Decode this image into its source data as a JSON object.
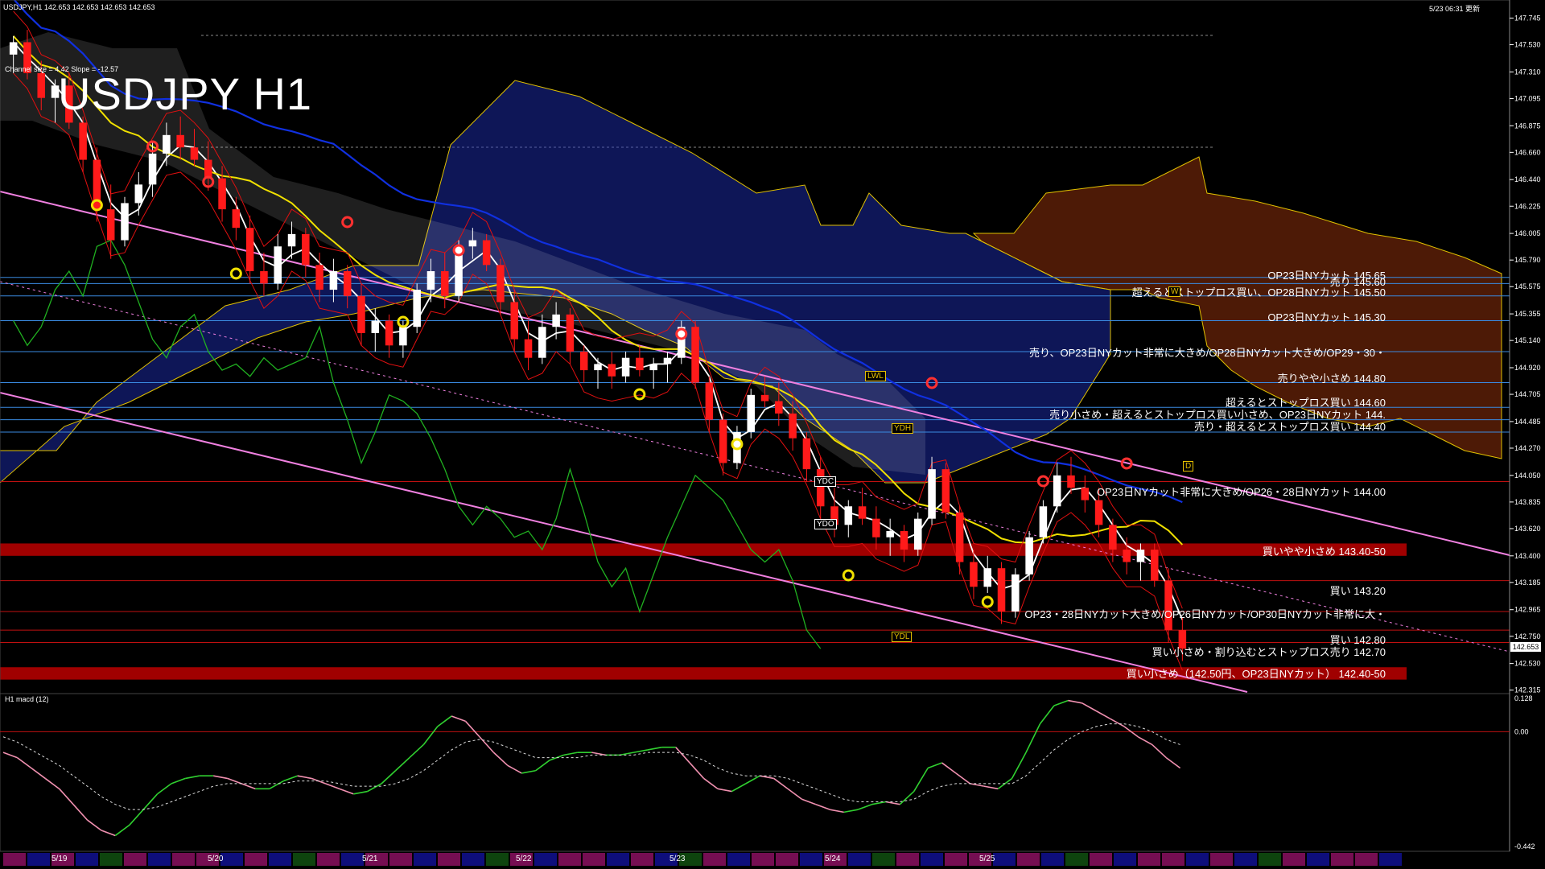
{
  "header": {
    "symbol_info": "USDJPY,H1  142.653 142.653 142.653 142.653",
    "datetime_label": "5/23 06:31 更新",
    "channel_info": "Channel size = 4.42  Slope = -12.57",
    "big_title": "USDJPY H1",
    "indicator_label": "H1  macd (12)",
    "current_price": "142.653"
  },
  "colors": {
    "background": "#000000",
    "bull_candle": "#ffffff",
    "bear_candle": "#ff1a1a",
    "ma_fast": "#ffffff",
    "ma_mid": "#f0e000",
    "ma_slow": "#1030e0",
    "channel": "#f080e0",
    "kumo_bull": "#2030c0",
    "kumo_bear": "#c04010",
    "lagging": "#20b020",
    "zone": "#a00000"
  },
  "levels": [
    {
      "text": "OP23日NYカット 145.65",
      "color": "#4aa0ff"
    },
    {
      "text": "売り 145.60",
      "color": "#4aa0ff"
    },
    {
      "text": "超えるとストップロス買い、OP28日NYカット 145.50",
      "color": "#4aa0ff"
    },
    {
      "text": "OP23日NYカット 145.30",
      "color": "#4aa0ff"
    },
    {
      "text": "売り、OP23日NYカット非常に大きめ/OP28日NYカット大きめ/OP29・30・",
      "color": "#4aa0ff"
    },
    {
      "text": "売りやや小さめ 144.80",
      "color": "#4aa0ff"
    },
    {
      "text": "超えるとストップロス買い 144.60",
      "color": "#4aa0ff"
    },
    {
      "text": "売り小さめ・超えるとストップロス買い小さめ、OP23日NYカット 144.",
      "color": "#4aa0ff"
    },
    {
      "text": "売り・超えるとストップロス買い 144.40",
      "color": "#4aa0ff"
    },
    {
      "text": "OP23日NYカット非常に大きめ/OP26・28日NYカット 144.00",
      "color": "#ff3030"
    },
    {
      "text": "買いやや小さめ 143.40-50",
      "color": "#ff3030"
    },
    {
      "text": "買い 143.20",
      "color": "#ff3030"
    },
    {
      "text": "OP23・28日NYカット大きめ/OP26日NYカット/OP30日NYカット非常に大・",
      "color": "#ff3030"
    },
    {
      "text": "買い 142.80",
      "color": "#ff3030"
    },
    {
      "text": "買い小さめ・割り込むとストップロス売り 142.70",
      "color": "#ff3030"
    },
    {
      "text": "買い小さめ（142.50円、OP23日NYカット） 142.40-50",
      "color": "#ff3030"
    }
  ],
  "tags": {
    "lwl": "LWL",
    "ydh": "YDH",
    "ydc": "YDC",
    "ydo": "YDO",
    "ydl": "YDL",
    "d": "D",
    "w": "W"
  },
  "x_dates": [
    "5/19",
    "5/20",
    "5/21",
    "5/22",
    "5/23",
    "5/24",
    "5/25"
  ],
  "chart_data": {
    "type": "candlestick",
    "title": "USDJPY H1",
    "y_axis_labels": [
      "147.745",
      "147.530",
      "147.310",
      "147.095",
      "146.875",
      "146.660",
      "146.440",
      "146.225",
      "146.005",
      "145.790",
      "145.575",
      "145.355",
      "145.140",
      "144.920",
      "144.705",
      "144.485",
      "144.270",
      "144.050",
      "143.835",
      "143.620",
      "143.400",
      "143.185",
      "142.965",
      "142.750",
      "142.530",
      "142.315"
    ],
    "ylim": [
      142.3,
      147.8
    ],
    "macd_axis_labels": [
      "0.128",
      "0.00",
      "-0.442"
    ],
    "macd_ylim": [
      -0.442,
      0.128
    ],
    "candles": [
      [
        147.45,
        147.6,
        147.3,
        147.55
      ],
      [
        147.55,
        147.65,
        147.25,
        147.3
      ],
      [
        147.3,
        147.4,
        147.0,
        147.1
      ],
      [
        147.1,
        147.25,
        146.9,
        147.2
      ],
      [
        147.2,
        147.3,
        146.85,
        146.9
      ],
      [
        146.9,
        146.95,
        146.5,
        146.6
      ],
      [
        146.6,
        146.7,
        146.1,
        146.2
      ],
      [
        146.2,
        146.4,
        145.8,
        145.95
      ],
      [
        145.95,
        146.3,
        145.9,
        146.25
      ],
      [
        146.25,
        146.5,
        146.15,
        146.4
      ],
      [
        146.4,
        146.75,
        146.3,
        146.65
      ],
      [
        146.65,
        146.9,
        146.55,
        146.8
      ],
      [
        146.8,
        146.95,
        146.6,
        146.7
      ],
      [
        146.7,
        146.85,
        146.55,
        146.6
      ],
      [
        146.6,
        146.75,
        146.35,
        146.45
      ],
      [
        146.45,
        146.55,
        146.1,
        146.2
      ],
      [
        146.2,
        146.3,
        145.95,
        146.05
      ],
      [
        146.05,
        146.15,
        145.6,
        145.7
      ],
      [
        145.7,
        145.85,
        145.5,
        145.6
      ],
      [
        145.6,
        146.0,
        145.55,
        145.9
      ],
      [
        145.9,
        146.1,
        145.8,
        146.0
      ],
      [
        146.0,
        146.05,
        145.65,
        145.75
      ],
      [
        145.75,
        145.85,
        145.45,
        145.55
      ],
      [
        145.55,
        145.8,
        145.45,
        145.7
      ],
      [
        145.7,
        145.75,
        145.4,
        145.5
      ],
      [
        145.5,
        145.6,
        145.1,
        145.2
      ],
      [
        145.2,
        145.4,
        145.05,
        145.3
      ],
      [
        145.3,
        145.35,
        145.0,
        145.1
      ],
      [
        145.1,
        145.3,
        145.0,
        145.25
      ],
      [
        145.25,
        145.6,
        145.2,
        145.55
      ],
      [
        145.55,
        145.8,
        145.45,
        145.7
      ],
      [
        145.7,
        145.85,
        145.4,
        145.5
      ],
      [
        145.5,
        145.95,
        145.45,
        145.9
      ],
      [
        145.9,
        146.05,
        145.8,
        145.95
      ],
      [
        145.95,
        146.0,
        145.7,
        145.75
      ],
      [
        145.75,
        145.8,
        145.35,
        145.45
      ],
      [
        145.45,
        145.55,
        145.05,
        145.15
      ],
      [
        145.15,
        145.3,
        144.9,
        145.0
      ],
      [
        145.0,
        145.35,
        144.95,
        145.25
      ],
      [
        145.25,
        145.45,
        145.15,
        145.35
      ],
      [
        145.35,
        145.4,
        144.95,
        145.05
      ],
      [
        145.05,
        145.1,
        144.8,
        144.9
      ],
      [
        144.9,
        145.0,
        144.75,
        144.95
      ],
      [
        144.95,
        145.05,
        144.75,
        144.85
      ],
      [
        144.85,
        145.05,
        144.8,
        145.0
      ],
      [
        145.0,
        145.1,
        144.85,
        144.9
      ],
      [
        144.9,
        145.0,
        144.75,
        144.95
      ],
      [
        144.95,
        145.05,
        144.8,
        145.0
      ],
      [
        145.0,
        145.3,
        144.95,
        145.25
      ],
      [
        145.25,
        145.3,
        144.75,
        144.8
      ],
      [
        144.8,
        144.85,
        144.4,
        144.5
      ],
      [
        144.5,
        144.55,
        144.05,
        144.15
      ],
      [
        144.15,
        144.45,
        144.1,
        144.4
      ],
      [
        144.4,
        144.75,
        144.35,
        144.7
      ],
      [
        144.7,
        144.85,
        144.6,
        144.65
      ],
      [
        144.65,
        144.8,
        144.45,
        144.55
      ],
      [
        144.55,
        144.65,
        144.25,
        144.35
      ],
      [
        144.35,
        144.4,
        144.0,
        144.1
      ],
      [
        144.1,
        144.2,
        143.7,
        143.8
      ],
      [
        143.8,
        143.95,
        143.55,
        143.65
      ],
      [
        143.65,
        143.85,
        143.55,
        143.8
      ],
      [
        143.8,
        143.95,
        143.65,
        143.7
      ],
      [
        143.7,
        143.8,
        143.45,
        143.55
      ],
      [
        143.55,
        143.7,
        143.4,
        143.6
      ],
      [
        143.6,
        143.65,
        143.35,
        143.45
      ],
      [
        143.45,
        143.75,
        143.4,
        143.7
      ],
      [
        143.7,
        144.2,
        143.65,
        144.1
      ],
      [
        144.1,
        144.15,
        143.7,
        143.75
      ],
      [
        143.75,
        143.8,
        143.25,
        143.35
      ],
      [
        143.35,
        143.45,
        143.05,
        143.15
      ],
      [
        143.15,
        143.4,
        143.1,
        143.3
      ],
      [
        143.3,
        143.35,
        142.85,
        142.95
      ],
      [
        142.95,
        143.3,
        142.9,
        143.25
      ],
      [
        143.25,
        143.6,
        143.2,
        143.55
      ],
      [
        143.55,
        143.85,
        143.5,
        143.8
      ],
      [
        143.8,
        144.15,
        143.75,
        144.05
      ],
      [
        144.05,
        144.2,
        143.9,
        143.95
      ],
      [
        143.95,
        144.05,
        143.75,
        143.85
      ],
      [
        143.85,
        143.95,
        143.55,
        143.65
      ],
      [
        143.65,
        143.7,
        143.35,
        143.45
      ],
      [
        143.45,
        143.55,
        143.25,
        143.35
      ],
      [
        143.35,
        143.5,
        143.2,
        143.45
      ],
      [
        143.45,
        143.5,
        143.15,
        143.2
      ],
      [
        143.2,
        143.3,
        142.7,
        142.8
      ],
      [
        142.8,
        142.9,
        142.55,
        142.65
      ]
    ],
    "macd": [
      -0.08,
      -0.1,
      -0.14,
      -0.18,
      -0.22,
      -0.28,
      -0.34,
      -0.38,
      -0.4,
      -0.36,
      -0.3,
      -0.24,
      -0.2,
      -0.18,
      -0.17,
      -0.17,
      -0.18,
      -0.2,
      -0.22,
      -0.22,
      -0.19,
      -0.17,
      -0.18,
      -0.2,
      -0.22,
      -0.24,
      -0.23,
      -0.2,
      -0.15,
      -0.1,
      -0.05,
      0.02,
      0.06,
      0.04,
      -0.02,
      -0.08,
      -0.13,
      -0.16,
      -0.15,
      -0.11,
      -0.09,
      -0.08,
      -0.08,
      -0.09,
      -0.09,
      -0.08,
      -0.07,
      -0.06,
      -0.06,
      -0.12,
      -0.18,
      -0.22,
      -0.23,
      -0.2,
      -0.17,
      -0.18,
      -0.22,
      -0.26,
      -0.28,
      -0.3,
      -0.31,
      -0.3,
      -0.28,
      -0.27,
      -0.28,
      -0.23,
      -0.14,
      -0.12,
      -0.16,
      -0.2,
      -0.21,
      -0.22,
      -0.18,
      -0.08,
      0.03,
      0.1,
      0.12,
      0.11,
      0.08,
      0.05,
      0.02,
      -0.02,
      -0.05,
      -0.1,
      -0.14
    ],
    "macd_signal": [
      -0.02,
      -0.04,
      -0.07,
      -0.1,
      -0.13,
      -0.17,
      -0.21,
      -0.25,
      -0.28,
      -0.3,
      -0.3,
      -0.29,
      -0.27,
      -0.25,
      -0.23,
      -0.21,
      -0.2,
      -0.2,
      -0.2,
      -0.2,
      -0.2,
      -0.19,
      -0.19,
      -0.19,
      -0.2,
      -0.21,
      -0.21,
      -0.21,
      -0.2,
      -0.18,
      -0.15,
      -0.11,
      -0.07,
      -0.04,
      -0.03,
      -0.04,
      -0.06,
      -0.08,
      -0.1,
      -0.1,
      -0.1,
      -0.1,
      -0.09,
      -0.09,
      -0.09,
      -0.09,
      -0.08,
      -0.08,
      -0.08,
      -0.09,
      -0.11,
      -0.14,
      -0.16,
      -0.17,
      -0.17,
      -0.17,
      -0.18,
      -0.2,
      -0.22,
      -0.24,
      -0.26,
      -0.27,
      -0.27,
      -0.27,
      -0.27,
      -0.26,
      -0.23,
      -0.21,
      -0.2,
      -0.2,
      -0.2,
      -0.2,
      -0.2,
      -0.17,
      -0.12,
      -0.07,
      -0.03,
      0.0,
      0.02,
      0.03,
      0.03,
      0.02,
      0.0,
      -0.03,
      -0.05
    ]
  }
}
